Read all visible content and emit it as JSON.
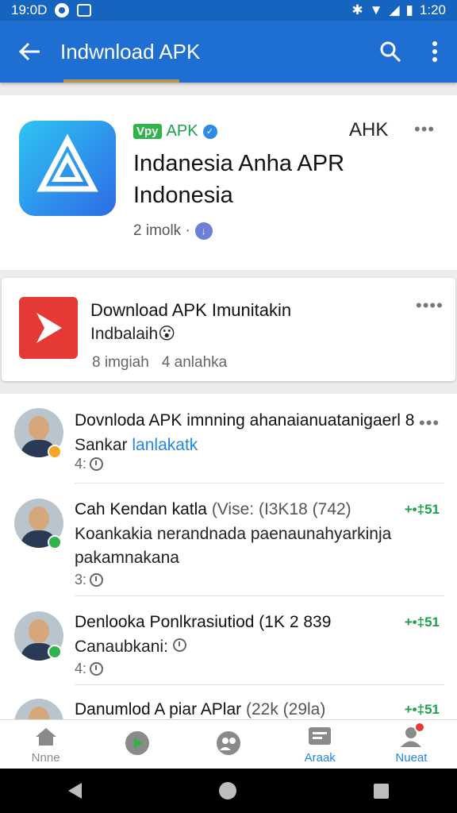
{
  "status_bar": {
    "time_left": "19:0D",
    "time_right": "1:20",
    "signal_text": "⁴ᴳ"
  },
  "app_bar": {
    "title": "Indwnload APK"
  },
  "app_card": {
    "badge": "Vpy",
    "badge_label": "APK",
    "apk_mark": "AHK",
    "name": "Indanesia Anha APR Indonesia",
    "meta": "2 imolk ·",
    "accent": "#1e6fd1"
  },
  "download_card": {
    "title": "Download APK Imunitakin",
    "subtitle": "Indbalaih",
    "meta_1": "8 imgiah",
    "meta_2": "4 anlahka"
  },
  "feed": [
    {
      "title": "Dovnloda APK imnning ahanaianuatanigaerl 8",
      "title_muted": "",
      "body": "Sankar",
      "link": "lanlakatk",
      "time": "4:",
      "stat": "",
      "badge_color": "#f5a623"
    },
    {
      "title": "Cah Kendan katla",
      "title_muted": "(Vise: (I3K18 (742)",
      "body": "Koankakia nerandnada paenaunahyarkinja pakamnakana",
      "link": "",
      "time": "3:",
      "stat": "+•‡51",
      "badge_color": "#2fb34a"
    },
    {
      "title": "Denlooka Ponlkrasiutiod (1K 2 839",
      "title_muted": "",
      "body": "Canaubkani:",
      "link": "",
      "time": "4:",
      "stat": "+•‡51",
      "badge_color": "#2fb34a"
    },
    {
      "title": "Danumlod A piar APlar",
      "title_muted": "(22k (29la)",
      "body": "",
      "link": "",
      "time": "",
      "stat": "+•‡51",
      "badge_color": "#2fb34a"
    }
  ],
  "bottom_nav": [
    {
      "label": "Nnne",
      "icon": "home-icon",
      "active": false
    },
    {
      "label": "",
      "icon": "play-store-icon",
      "active": false
    },
    {
      "label": "",
      "icon": "people-icon",
      "active": false
    },
    {
      "label": "Araak",
      "icon": "inbox-icon",
      "active": true
    },
    {
      "label": "Nueat",
      "icon": "notification-icon",
      "active": true
    }
  ]
}
